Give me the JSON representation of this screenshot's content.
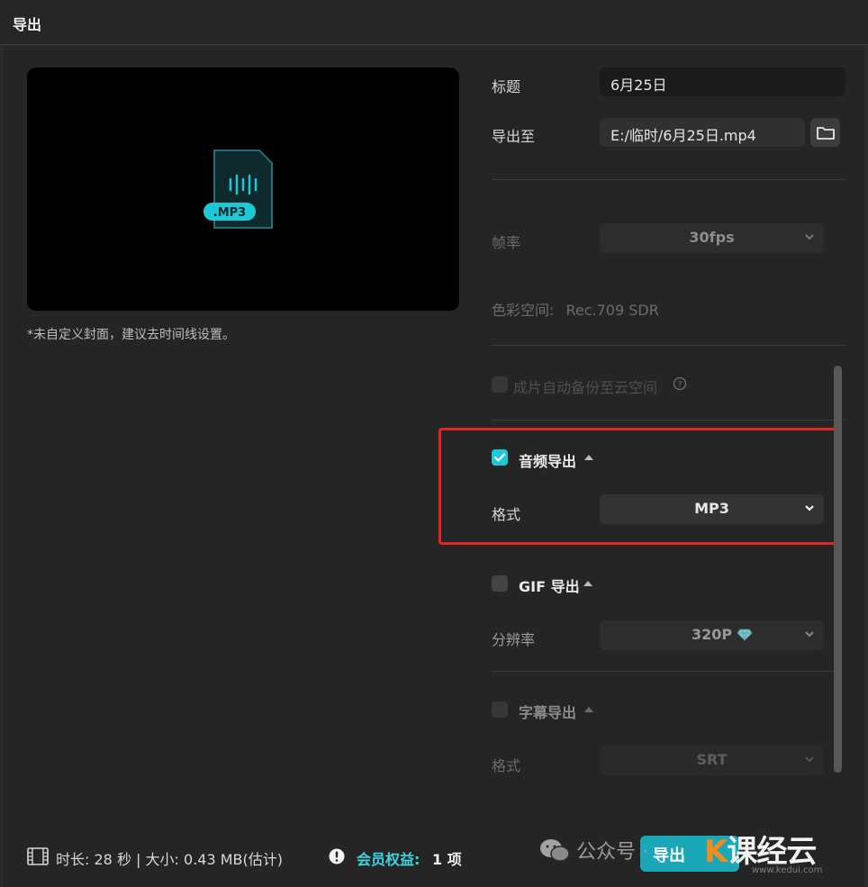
{
  "window": {
    "title": "导出"
  },
  "preview": {
    "file_badge": ".MP3",
    "cover_note": "*未自定义封面，建议去时间线设置。"
  },
  "settings": {
    "title_label": "标题",
    "title_value": "6月25日",
    "export_to_label": "导出至",
    "export_path": "E:/临时/6月25日.mp4",
    "framerate_label": "帧率",
    "framerate_value": "30fps",
    "colorspace_label": "色彩空间:",
    "colorspace_value": "Rec.709 SDR",
    "cloud_backup_label": "成片自动备份至云空间"
  },
  "audio_export": {
    "title": "音频导出",
    "checked": true,
    "format_label": "格式",
    "format_value": "MP3"
  },
  "gif_export": {
    "title": "GIF 导出",
    "checked": false,
    "resolution_label": "分辨率",
    "resolution_value": "320P"
  },
  "subtitle_export": {
    "title": "字幕导出",
    "checked": false,
    "format_label": "格式",
    "format_value": "SRT"
  },
  "footer": {
    "duration_label": "时长:",
    "duration_value": "28 秒",
    "size_sep": "|",
    "size_label": "大小:",
    "size_value": "0.43 MB",
    "estimate": "(估计)",
    "vip_label": "会员权益:",
    "vip_value": "1 项",
    "export_button": "导出"
  },
  "watermark": {
    "text": "公众号 ·",
    "brand": "课经云",
    "brand_sub": "www.kedui.com"
  },
  "colors": {
    "accent": "#1ec8d6",
    "highlight": "#e02525",
    "background": "#252525"
  }
}
